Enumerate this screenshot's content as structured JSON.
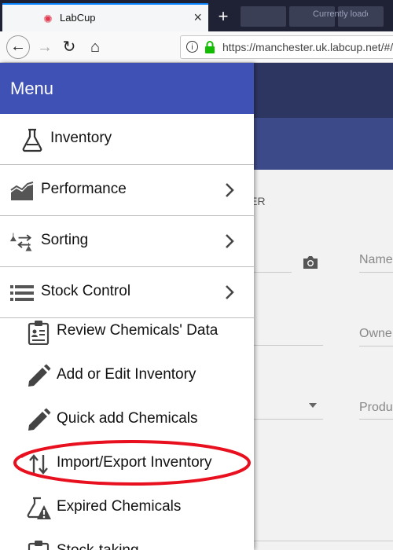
{
  "browser": {
    "tab_title": "LabCup",
    "background_tab_label": "Currently loaded",
    "url": "https://manchester.uk.labcup.net/#/"
  },
  "background_page": {
    "tab_fragment": "HER",
    "field_labels": [
      "Name",
      "Owne",
      "Produ"
    ]
  },
  "menu": {
    "title": "Menu",
    "items": [
      {
        "label": "Inventory",
        "icon": "flask-icon",
        "has_chevron": false
      },
      {
        "label": "Performance",
        "icon": "area-chart-icon",
        "has_chevron": true
      },
      {
        "label": "Sorting",
        "icon": "sorting-icon",
        "has_chevron": true
      },
      {
        "label": "Stock Control",
        "icon": "stock-list-icon",
        "has_chevron": true
      }
    ],
    "submenu": [
      {
        "label": "Review Chemicals' Data",
        "icon": "clipboard-icon"
      },
      {
        "label": "Add or Edit Inventory",
        "icon": "pencil-icon"
      },
      {
        "label": "Quick add Chemicals",
        "icon": "pencil-icon"
      },
      {
        "label": "Import/Export Inventory",
        "icon": "import-export-icon"
      },
      {
        "label": "Expired Chemicals",
        "icon": "expired-warning-icon"
      },
      {
        "label": "Stock-taking",
        "icon": "clipboard-icon"
      }
    ]
  },
  "colors": {
    "menu_header": "#3f51b5",
    "app_header": "#2d3561",
    "highlight": "#e8101e"
  }
}
